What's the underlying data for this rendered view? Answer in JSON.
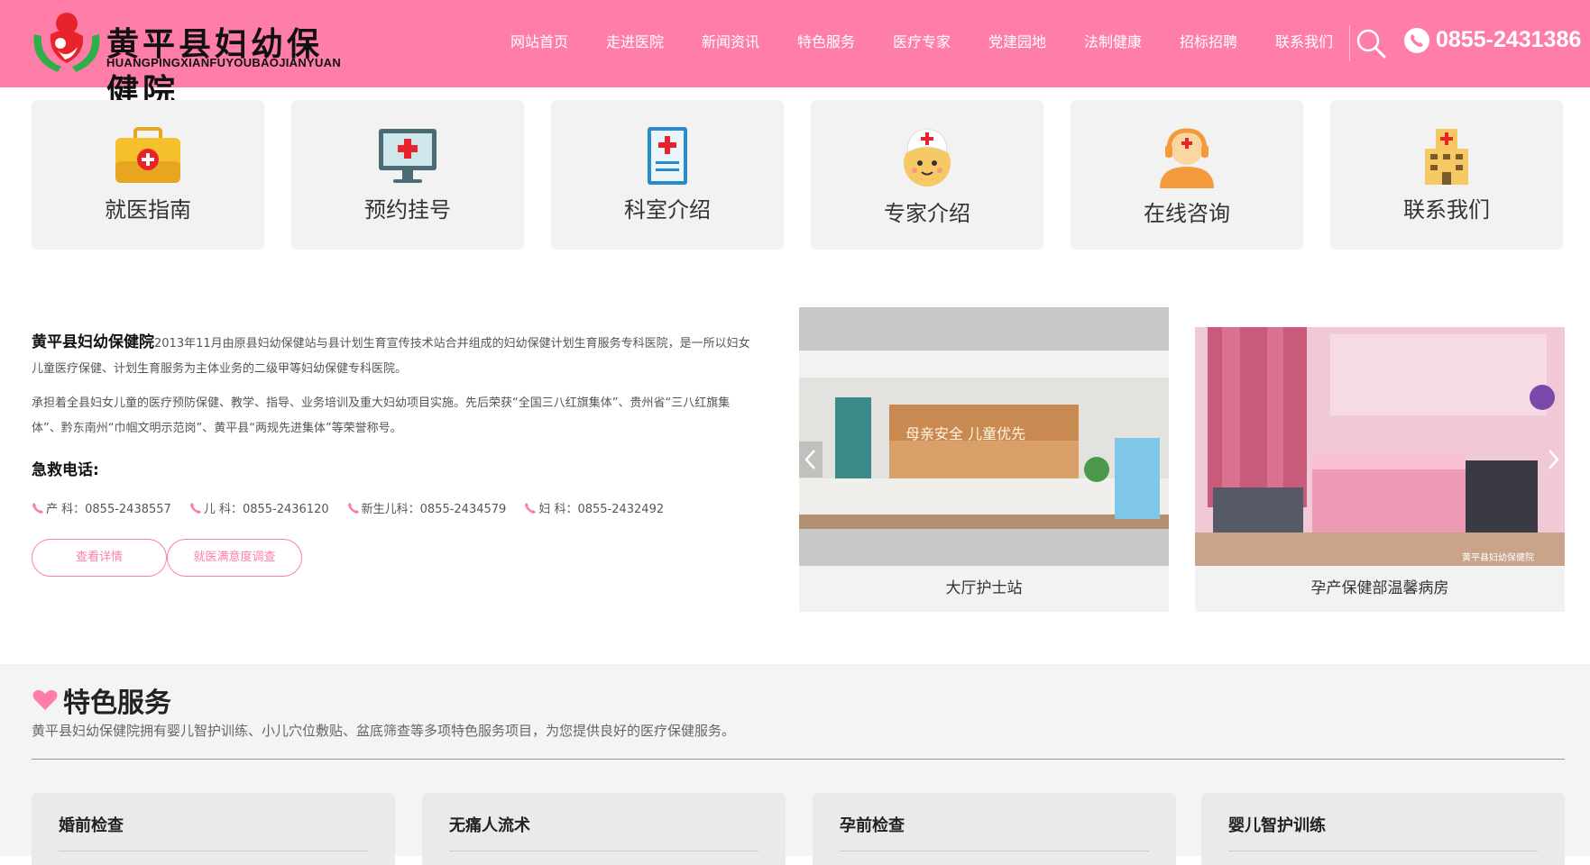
{
  "header": {
    "logo_cn": "黄平县妇幼保健院",
    "logo_en": "HUANGPINGXIANFUYOUBAOJIANYUAN",
    "nav": [
      "网站首页",
      "走进医院",
      "新闻资讯",
      "特色服务",
      "医疗专家",
      "党建园地",
      "法制健康",
      "招标招聘",
      "联系我们"
    ],
    "phone": "0855-2431386",
    "brand_color": "#ff7ea8"
  },
  "quick_links": [
    {
      "label": "就医指南",
      "icon": "medical-kit-icon"
    },
    {
      "label": "预约挂号",
      "icon": "monitor-cross-icon"
    },
    {
      "label": "科室介绍",
      "icon": "clipboard-cross-icon"
    },
    {
      "label": "专家介绍",
      "icon": "nurse-face-icon"
    },
    {
      "label": "在线咨询",
      "icon": "headset-agent-icon"
    },
    {
      "label": "联系我们",
      "icon": "hospital-building-icon"
    }
  ],
  "about": {
    "name": "黄平县妇幼保健院",
    "p1": "2013年11月由原县妇幼保健站与县计划生育宣传技术站合并组成的妇幼保健计划生育服务专科医院，是一所以妇女儿童医疗保健、计划生育服务为主体业务的二级甲等妇幼保健专科医院。",
    "p2": "承担着全县妇女儿童的医疗预防保健、教学、指导、业务培训及重大妇幼项目实施。先后荣获“全国三八红旗集体”、贵州省“三八红旗集体”、黔东南州“巾帼文明示范岗”、黄平县“两规先进集体”等荣誉称号。",
    "emergency_title": "急救电话:",
    "phones": [
      "产 科：0855-2438557",
      "儿 科：0855-2436120",
      "新生儿科：0855-2434579",
      "妇 科：0855-2432492"
    ],
    "buttons": [
      "查看详情",
      "就医满意度调查"
    ]
  },
  "gallery": [
    {
      "caption": "大厅护士站",
      "sign": "母亲安全 儿童优先"
    },
    {
      "caption": "孕产保健部温馨病房",
      "watermark": "黄平县妇幼保健院"
    }
  ],
  "features": {
    "title": "特色服务",
    "desc": "黄平县妇幼保健院拥有婴儿智护训练、小儿穴位敷贴、盆底筛查等多项特色服务项目，为您提供良好的医疗保健服务。",
    "items": [
      "婚前检查",
      "无痛人流术",
      "孕前检查",
      "婴儿智护训练"
    ]
  }
}
